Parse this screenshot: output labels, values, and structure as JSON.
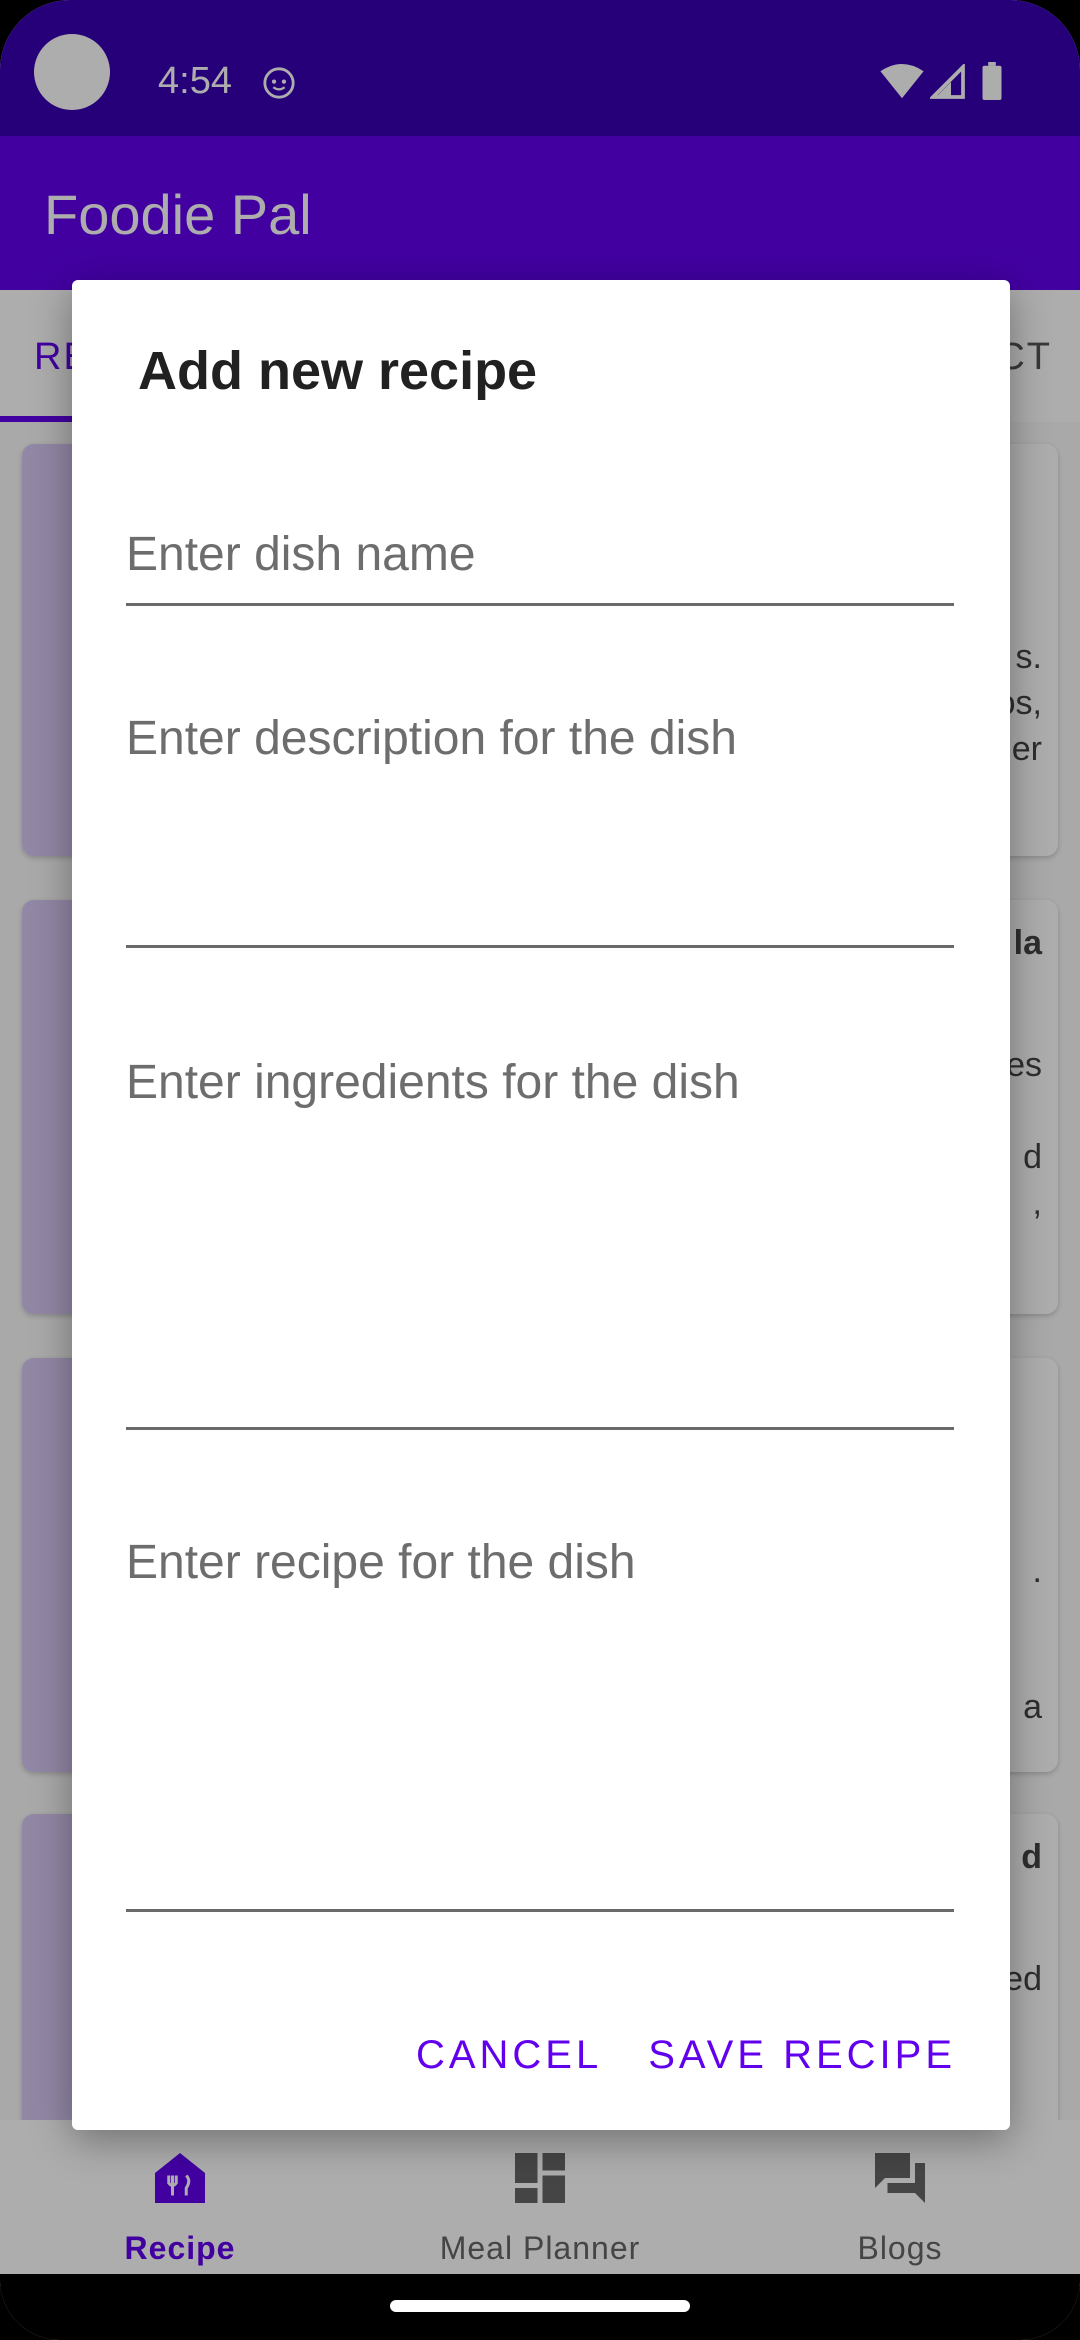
{
  "status_bar": {
    "time": "4:54",
    "icons": [
      "notification-icon",
      "wifi-icon",
      "signal-icon",
      "battery-icon"
    ]
  },
  "app_bar": {
    "title": "Foodie Pal"
  },
  "tabs": {
    "left_partial": "RE",
    "right_partial": "CT"
  },
  "background_cards": [
    {
      "snippets": [
        "s.",
        "os,",
        "er"
      ]
    },
    {
      "snippets": [
        "la",
        "es",
        "d",
        ","
      ]
    },
    {
      "snippets": [
        ".",
        "a"
      ]
    },
    {
      "snippets": [
        "d",
        "ed"
      ]
    }
  ],
  "dialog": {
    "title": "Add new recipe",
    "fields": {
      "dish_name": {
        "placeholder": "Enter dish name",
        "value": ""
      },
      "description": {
        "placeholder": "Enter description for the dish",
        "value": ""
      },
      "ingredients": {
        "placeholder": "Enter ingredients for the dish",
        "value": ""
      },
      "recipe": {
        "placeholder": "Enter recipe for the dish",
        "value": ""
      }
    },
    "actions": {
      "cancel": "CANCEL",
      "save": "SAVE RECIPE"
    }
  },
  "bottom_nav": {
    "items": [
      {
        "label": "Recipe",
        "icon": "recipe-icon",
        "active": true
      },
      {
        "label": "Meal Planner",
        "icon": "dashboard-icon",
        "active": false
      },
      {
        "label": "Blogs",
        "icon": "forum-icon",
        "active": false
      }
    ]
  },
  "colors": {
    "primary": "#6200ee",
    "primary_dark": "#3800b3",
    "thumb": "#d7c8f3"
  }
}
